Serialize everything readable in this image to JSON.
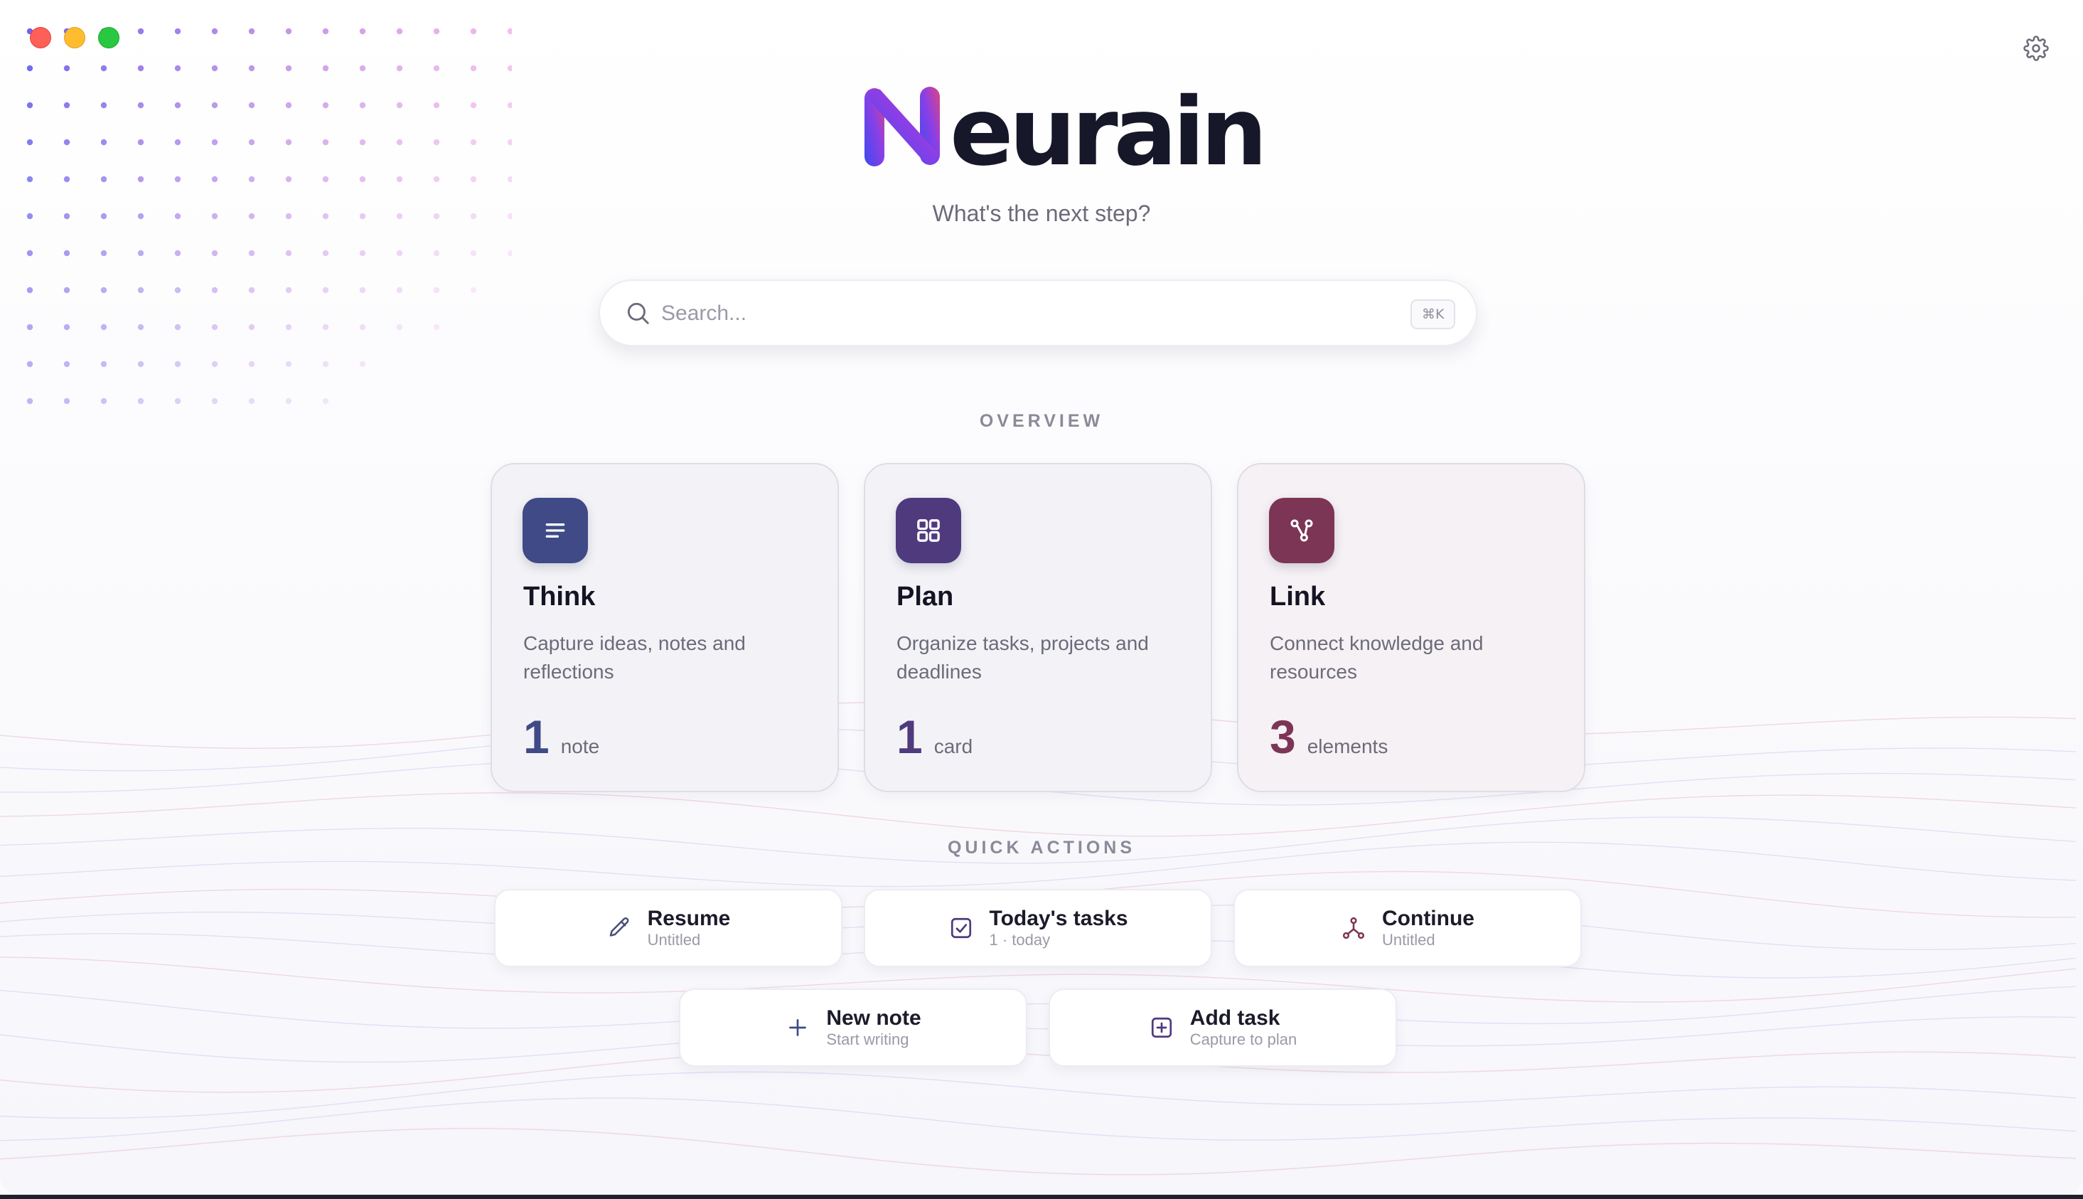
{
  "app": {
    "brand_word": "eurain",
    "tagline": "What's the next step?"
  },
  "search": {
    "placeholder": "Search...",
    "shortcut": "⌘K"
  },
  "overview": {
    "title": "OVERVIEW",
    "cards": [
      {
        "key": "think",
        "title": "Think",
        "description": "Capture ideas, notes and reflections",
        "count": "1",
        "unit": "note",
        "color": "#3f4a86",
        "icon": "document-lines-icon"
      },
      {
        "key": "plan",
        "title": "Plan",
        "description": "Organize tasks, projects and deadlines",
        "count": "1",
        "unit": "card",
        "color": "#4f3a7e",
        "icon": "grid-icon"
      },
      {
        "key": "link",
        "title": "Link",
        "description": "Connect knowledge and resources",
        "count": "3",
        "unit": "elements",
        "color": "#7c3555",
        "icon": "graph-nodes-icon"
      }
    ]
  },
  "quick_actions": {
    "title": "QUICK ACTIONS",
    "items": [
      {
        "label": "Resume",
        "sub": "Untitled",
        "icon": "pencil-icon"
      },
      {
        "label": "Today's tasks",
        "sub": "1 · today",
        "icon": "checkbox-icon"
      },
      {
        "label": "Continue",
        "sub": "Untitled",
        "icon": "graph-nodes-icon"
      },
      {
        "label": "New note",
        "sub": "Start writing",
        "icon": "plus-icon"
      },
      {
        "label": "Add task",
        "sub": "Capture to plan",
        "icon": "plus-square-icon"
      }
    ]
  },
  "colors": {
    "accent_gradient_start": "#3a4bf0",
    "accent_gradient_end": "#e0457f",
    "traffic_red": "#fe5f57",
    "traffic_yellow": "#febc2e",
    "traffic_green": "#28c840"
  }
}
